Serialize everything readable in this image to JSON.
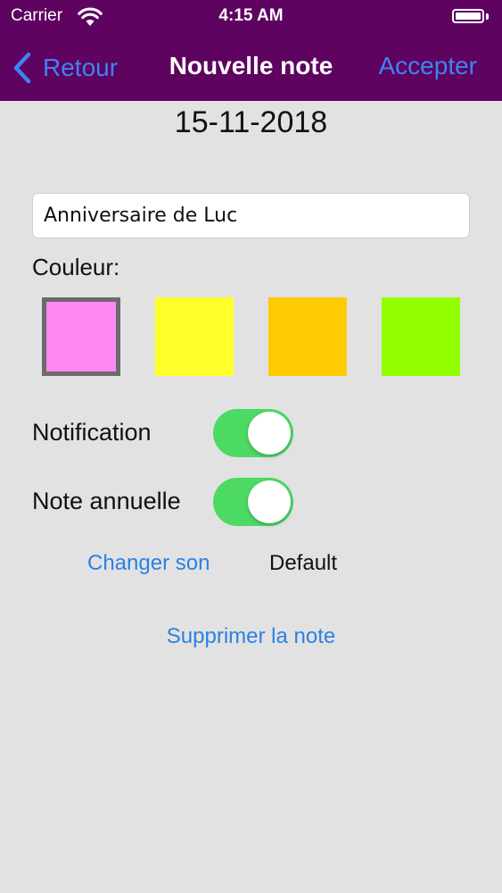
{
  "status_bar": {
    "carrier": "Carrier",
    "time": "4:15 AM"
  },
  "navbar": {
    "back_label": "Retour",
    "title": "Nouvelle note",
    "accept_label": "Accepter"
  },
  "note": {
    "date": "15-11-2018",
    "title_value": "Anniversaire de Luc"
  },
  "color_section": {
    "label": "Couleur:",
    "swatches": [
      {
        "color": "#ff88f5",
        "selected": true
      },
      {
        "color": "#ffff2a",
        "selected": false
      },
      {
        "color": "#ffca00",
        "selected": false
      },
      {
        "color": "#92ff00",
        "selected": false
      }
    ]
  },
  "settings": {
    "notification_label": "Notification",
    "notification_on": true,
    "annual_label": "Note annuelle",
    "annual_on": true,
    "change_sound_label": "Changer son",
    "sound_value": "Default",
    "delete_label": "Supprimer la note"
  },
  "colors": {
    "nav_bg": "#5e0360",
    "accent": "#2a82e4",
    "toggle_on": "#4cd964",
    "background": "#e2e2e2"
  }
}
